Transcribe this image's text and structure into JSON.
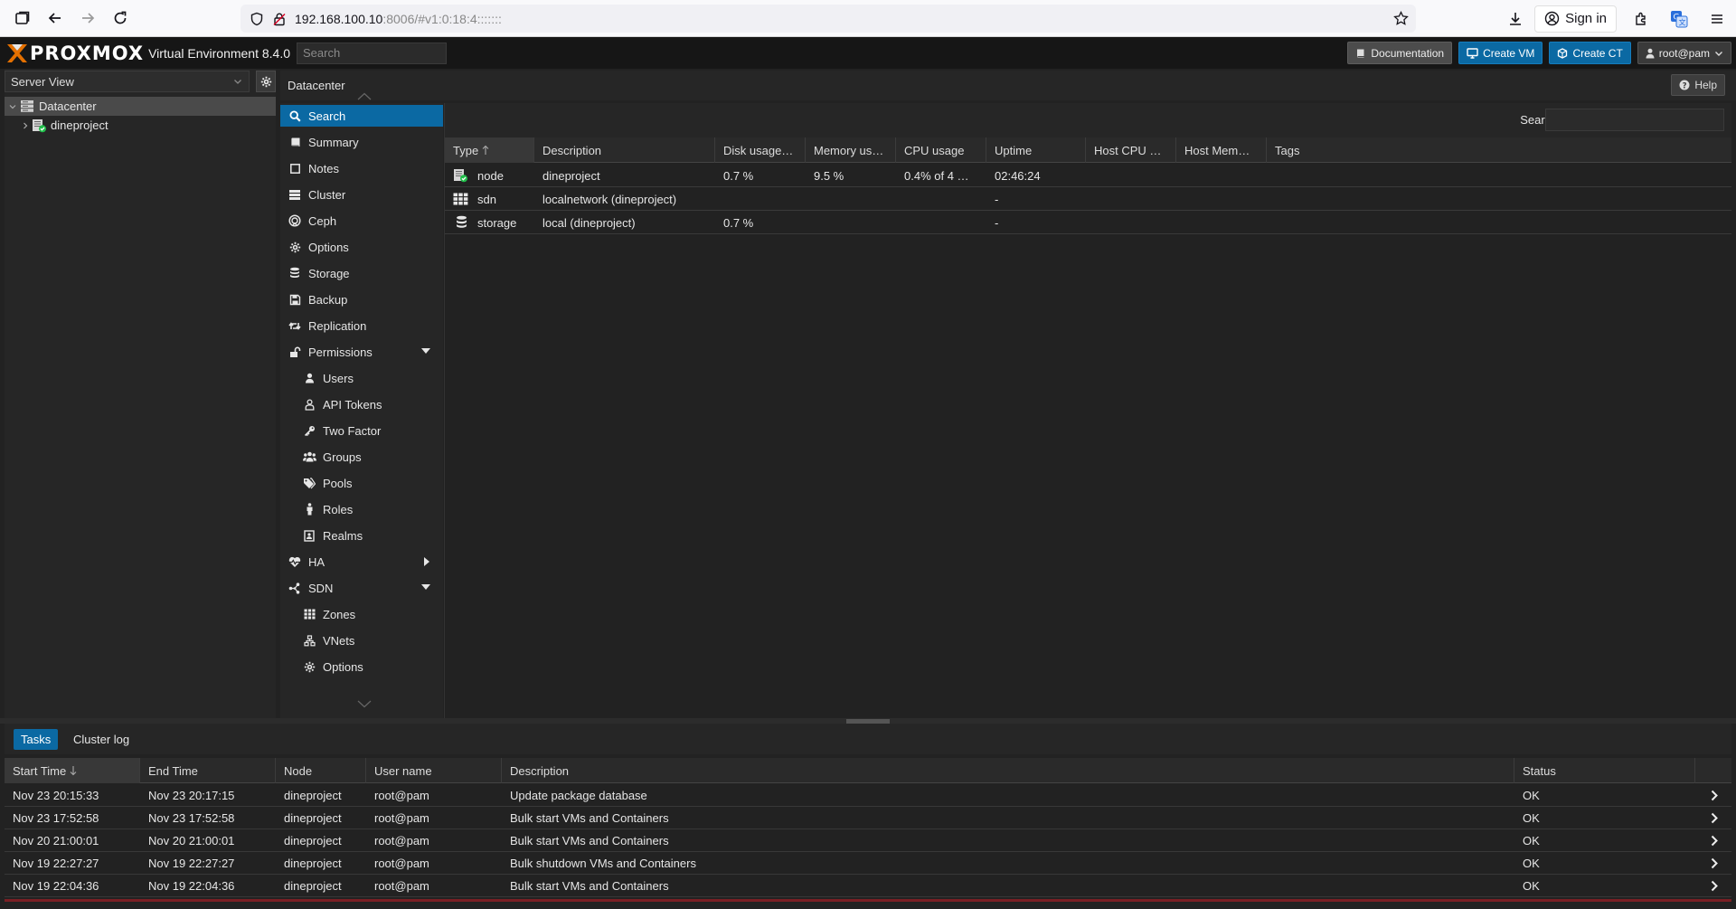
{
  "browser": {
    "url_host": "192.168.100.10",
    "url_rest": ":8006/#v1:0:18:4:::::::",
    "signin_label": "Sign in"
  },
  "header": {
    "logo_text": "PROXMOX",
    "version": "Virtual Environment 8.4.0",
    "search_placeholder": "Search",
    "doc_label": "Documentation",
    "create_vm_label": "Create VM",
    "create_ct_label": "Create CT",
    "user_label": "root@pam"
  },
  "tree": {
    "view_label": "Server View",
    "nodes": [
      {
        "label": "Datacenter"
      },
      {
        "label": "dineproject"
      }
    ]
  },
  "content": {
    "title": "Datacenter",
    "help_label": "Help"
  },
  "menu": {
    "items": [
      {
        "label": "Search",
        "icon": "search-icon"
      },
      {
        "label": "Summary",
        "icon": "book-icon"
      },
      {
        "label": "Notes",
        "icon": "note-icon"
      },
      {
        "label": "Cluster",
        "icon": "server-icon"
      },
      {
        "label": "Ceph",
        "icon": "ceph-icon"
      },
      {
        "label": "Options",
        "icon": "gear-icon"
      },
      {
        "label": "Storage",
        "icon": "database-icon"
      },
      {
        "label": "Backup",
        "icon": "floppy-icon"
      },
      {
        "label": "Replication",
        "icon": "retweet-icon"
      },
      {
        "label": "Permissions",
        "icon": "unlock-icon"
      },
      {
        "label": "Users",
        "icon": "user-icon"
      },
      {
        "label": "API Tokens",
        "icon": "key-user-icon"
      },
      {
        "label": "Two Factor",
        "icon": "key-icon"
      },
      {
        "label": "Groups",
        "icon": "users-icon"
      },
      {
        "label": "Pools",
        "icon": "tags-icon"
      },
      {
        "label": "Roles",
        "icon": "male-icon"
      },
      {
        "label": "Realms",
        "icon": "address-book-icon"
      },
      {
        "label": "HA",
        "icon": "heartbeat-icon"
      },
      {
        "label": "SDN",
        "icon": "sdn-icon"
      },
      {
        "label": "Zones",
        "icon": "grid-icon"
      },
      {
        "label": "VNets",
        "icon": "network-icon"
      },
      {
        "label": "Options",
        "icon": "gear-icon"
      }
    ]
  },
  "grid": {
    "search_label": "Search:",
    "columns": [
      "Type",
      "Description",
      "Disk usage…",
      "Memory us…",
      "CPU usage",
      "Uptime",
      "Host CPU …",
      "Host Mem…",
      "Tags"
    ],
    "rows": [
      {
        "type": "node",
        "icon": "node-online-icon",
        "description": "dineproject",
        "disk": "0.7 %",
        "memory": "9.5 %",
        "cpu": "0.4% of 4 …",
        "uptime": "02:46:24"
      },
      {
        "type": "sdn",
        "icon": "sdn-grid-icon",
        "description": "localnetwork (dineproject)",
        "disk": "",
        "memory": "",
        "cpu": "",
        "uptime": "-"
      },
      {
        "type": "storage",
        "icon": "storage-icon",
        "description": "local (dineproject)",
        "disk": "0.7 %",
        "memory": "",
        "cpu": "",
        "uptime": "-"
      }
    ]
  },
  "tasks": {
    "tabs": [
      "Tasks",
      "Cluster log"
    ],
    "columns": [
      "Start Time",
      "End Time",
      "Node",
      "User name",
      "Description",
      "Status"
    ],
    "rows": [
      {
        "start": "Nov 23 20:15:33",
        "end": "Nov 23 20:17:15",
        "node": "dineproject",
        "user": "root@pam",
        "description": "Update package database",
        "status": "OK"
      },
      {
        "start": "Nov 23 17:52:58",
        "end": "Nov 23 17:52:58",
        "node": "dineproject",
        "user": "root@pam",
        "description": "Bulk start VMs and Containers",
        "status": "OK"
      },
      {
        "start": "Nov 20 21:00:01",
        "end": "Nov 20 21:00:01",
        "node": "dineproject",
        "user": "root@pam",
        "description": "Bulk start VMs and Containers",
        "status": "OK"
      },
      {
        "start": "Nov 19 22:27:27",
        "end": "Nov 19 22:27:27",
        "node": "dineproject",
        "user": "root@pam",
        "description": "Bulk shutdown VMs and Containers",
        "status": "OK"
      },
      {
        "start": "Nov 19 22:04:36",
        "end": "Nov 19 22:04:36",
        "node": "dineproject",
        "user": "root@pam",
        "description": "Bulk start VMs and Containers",
        "status": "OK"
      }
    ]
  },
  "colors": {
    "accent": "#0b69a3",
    "ok": "#21bf4b",
    "logo_orange": "#e57000"
  }
}
